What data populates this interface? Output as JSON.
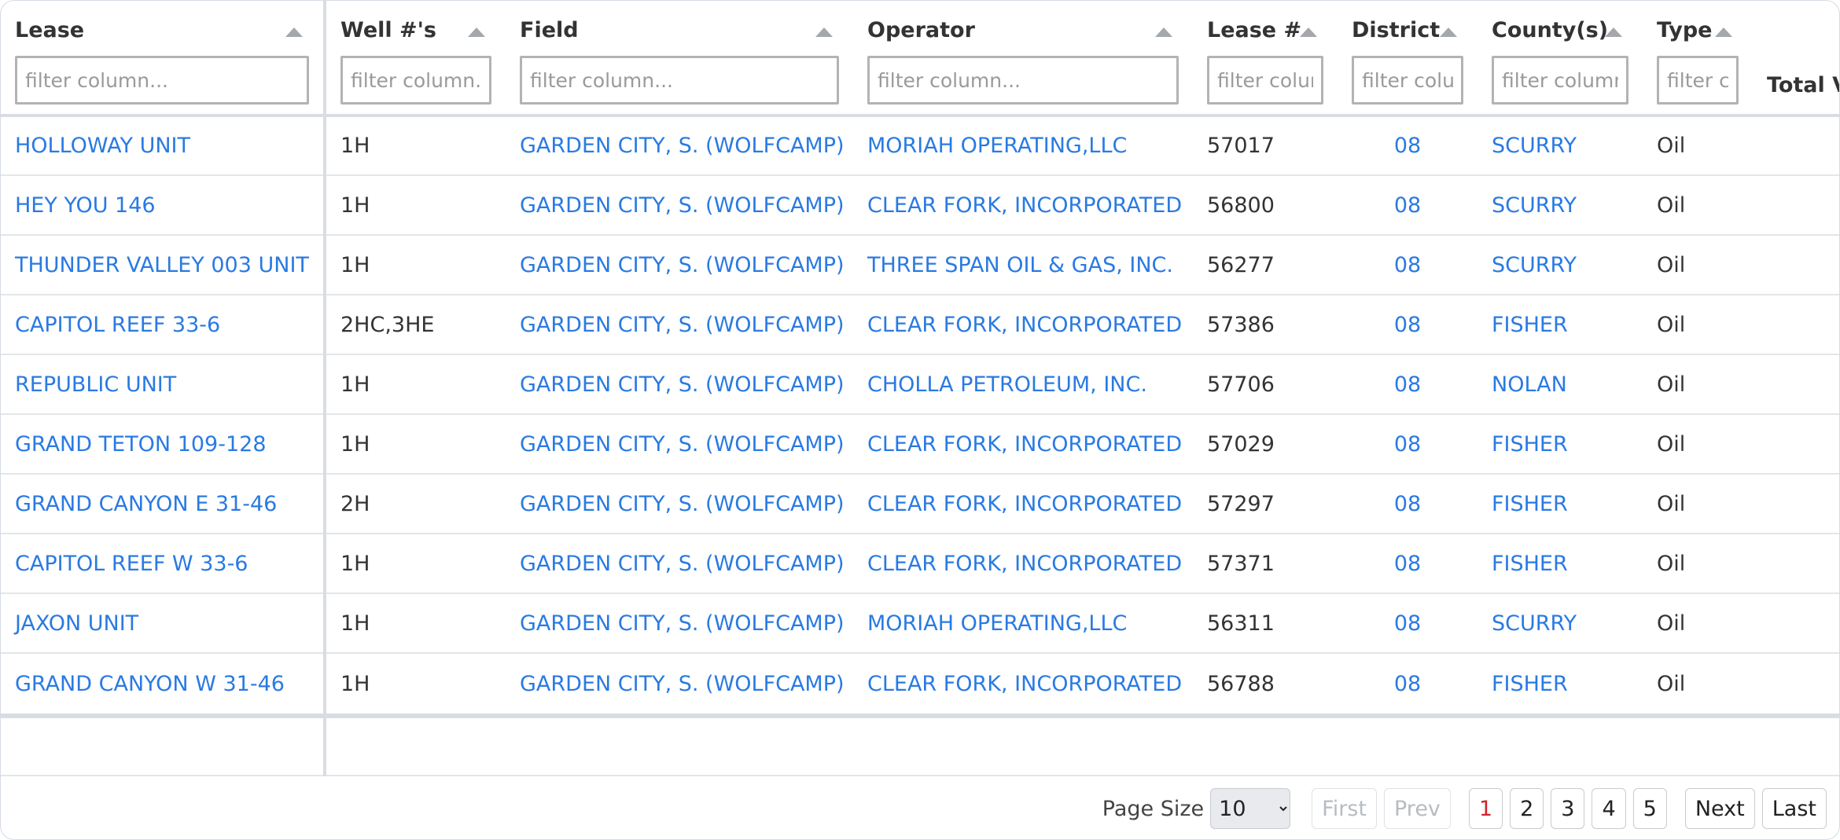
{
  "columns": [
    {
      "label": "Lease",
      "placeholder": "filter column..."
    },
    {
      "label": "Well #'s",
      "placeholder": "filter column..."
    },
    {
      "label": "Field",
      "placeholder": "filter column..."
    },
    {
      "label": "Operator",
      "placeholder": "filter column..."
    },
    {
      "label": "Lease #",
      "placeholder": "filter column..."
    },
    {
      "label": "District",
      "placeholder": "filter column..."
    },
    {
      "label": "County(s)",
      "placeholder": "filter column..."
    },
    {
      "label": "Type",
      "placeholder": "filter column..."
    },
    {
      "label": "Total V"
    }
  ],
  "rows": [
    {
      "lease": "HOLLOWAY UNIT",
      "wells": "1H",
      "field": "GARDEN CITY, S. (WOLFCAMP)",
      "operator": "MORIAH OPERATING,LLC",
      "lease_no": "57017",
      "district": "08",
      "county": "SCURRY",
      "type": "Oil"
    },
    {
      "lease": "HEY YOU 146",
      "wells": "1H",
      "field": "GARDEN CITY, S. (WOLFCAMP)",
      "operator": "CLEAR FORK, INCORPORATED",
      "lease_no": "56800",
      "district": "08",
      "county": "SCURRY",
      "type": "Oil"
    },
    {
      "lease": "THUNDER VALLEY 003 UNIT",
      "wells": "1H",
      "field": "GARDEN CITY, S. (WOLFCAMP)",
      "operator": "THREE SPAN OIL & GAS, INC.",
      "lease_no": "56277",
      "district": "08",
      "county": "SCURRY",
      "type": "Oil"
    },
    {
      "lease": "CAPITOL REEF 33-6",
      "wells": "2HC,3HE",
      "field": "GARDEN CITY, S. (WOLFCAMP)",
      "operator": "CLEAR FORK, INCORPORATED",
      "lease_no": "57386",
      "district": "08",
      "county": "FISHER",
      "type": "Oil"
    },
    {
      "lease": "REPUBLIC UNIT",
      "wells": "1H",
      "field": "GARDEN CITY, S. (WOLFCAMP)",
      "operator": "CHOLLA PETROLEUM, INC.",
      "lease_no": "57706",
      "district": "08",
      "county": "NOLAN",
      "type": "Oil"
    },
    {
      "lease": "GRAND TETON 109-128",
      "wells": "1H",
      "field": "GARDEN CITY, S. (WOLFCAMP)",
      "operator": "CLEAR FORK, INCORPORATED",
      "lease_no": "57029",
      "district": "08",
      "county": "FISHER",
      "type": "Oil"
    },
    {
      "lease": "GRAND CANYON E 31-46",
      "wells": "2H",
      "field": "GARDEN CITY, S. (WOLFCAMP)",
      "operator": "CLEAR FORK, INCORPORATED",
      "lease_no": "57297",
      "district": "08",
      "county": "FISHER",
      "type": "Oil"
    },
    {
      "lease": "CAPITOL REEF W 33-6",
      "wells": "1H",
      "field": "GARDEN CITY, S. (WOLFCAMP)",
      "operator": "CLEAR FORK, INCORPORATED",
      "lease_no": "57371",
      "district": "08",
      "county": "FISHER",
      "type": "Oil"
    },
    {
      "lease": "JAXON UNIT",
      "wells": "1H",
      "field": "GARDEN CITY, S. (WOLFCAMP)",
      "operator": "MORIAH OPERATING,LLC",
      "lease_no": "56311",
      "district": "08",
      "county": "SCURRY",
      "type": "Oil"
    },
    {
      "lease": "GRAND CANYON W 31-46",
      "wells": "1H",
      "field": "GARDEN CITY, S. (WOLFCAMP)",
      "operator": "CLEAR FORK, INCORPORATED",
      "lease_no": "56788",
      "district": "08",
      "county": "FISHER",
      "type": "Oil"
    }
  ],
  "pagination": {
    "page_size_label": "Page Size",
    "page_size_value": "10",
    "first": "First",
    "prev": "Prev",
    "pages": [
      "1",
      "2",
      "3",
      "4",
      "5"
    ],
    "current_page": "1",
    "next": "Next",
    "last": "Last"
  },
  "colors": {
    "link": "#2a7ae2",
    "current_page": "#d0252b",
    "border": "#d9dde3"
  },
  "icons": {
    "sort": "sort-ascending-icon"
  }
}
